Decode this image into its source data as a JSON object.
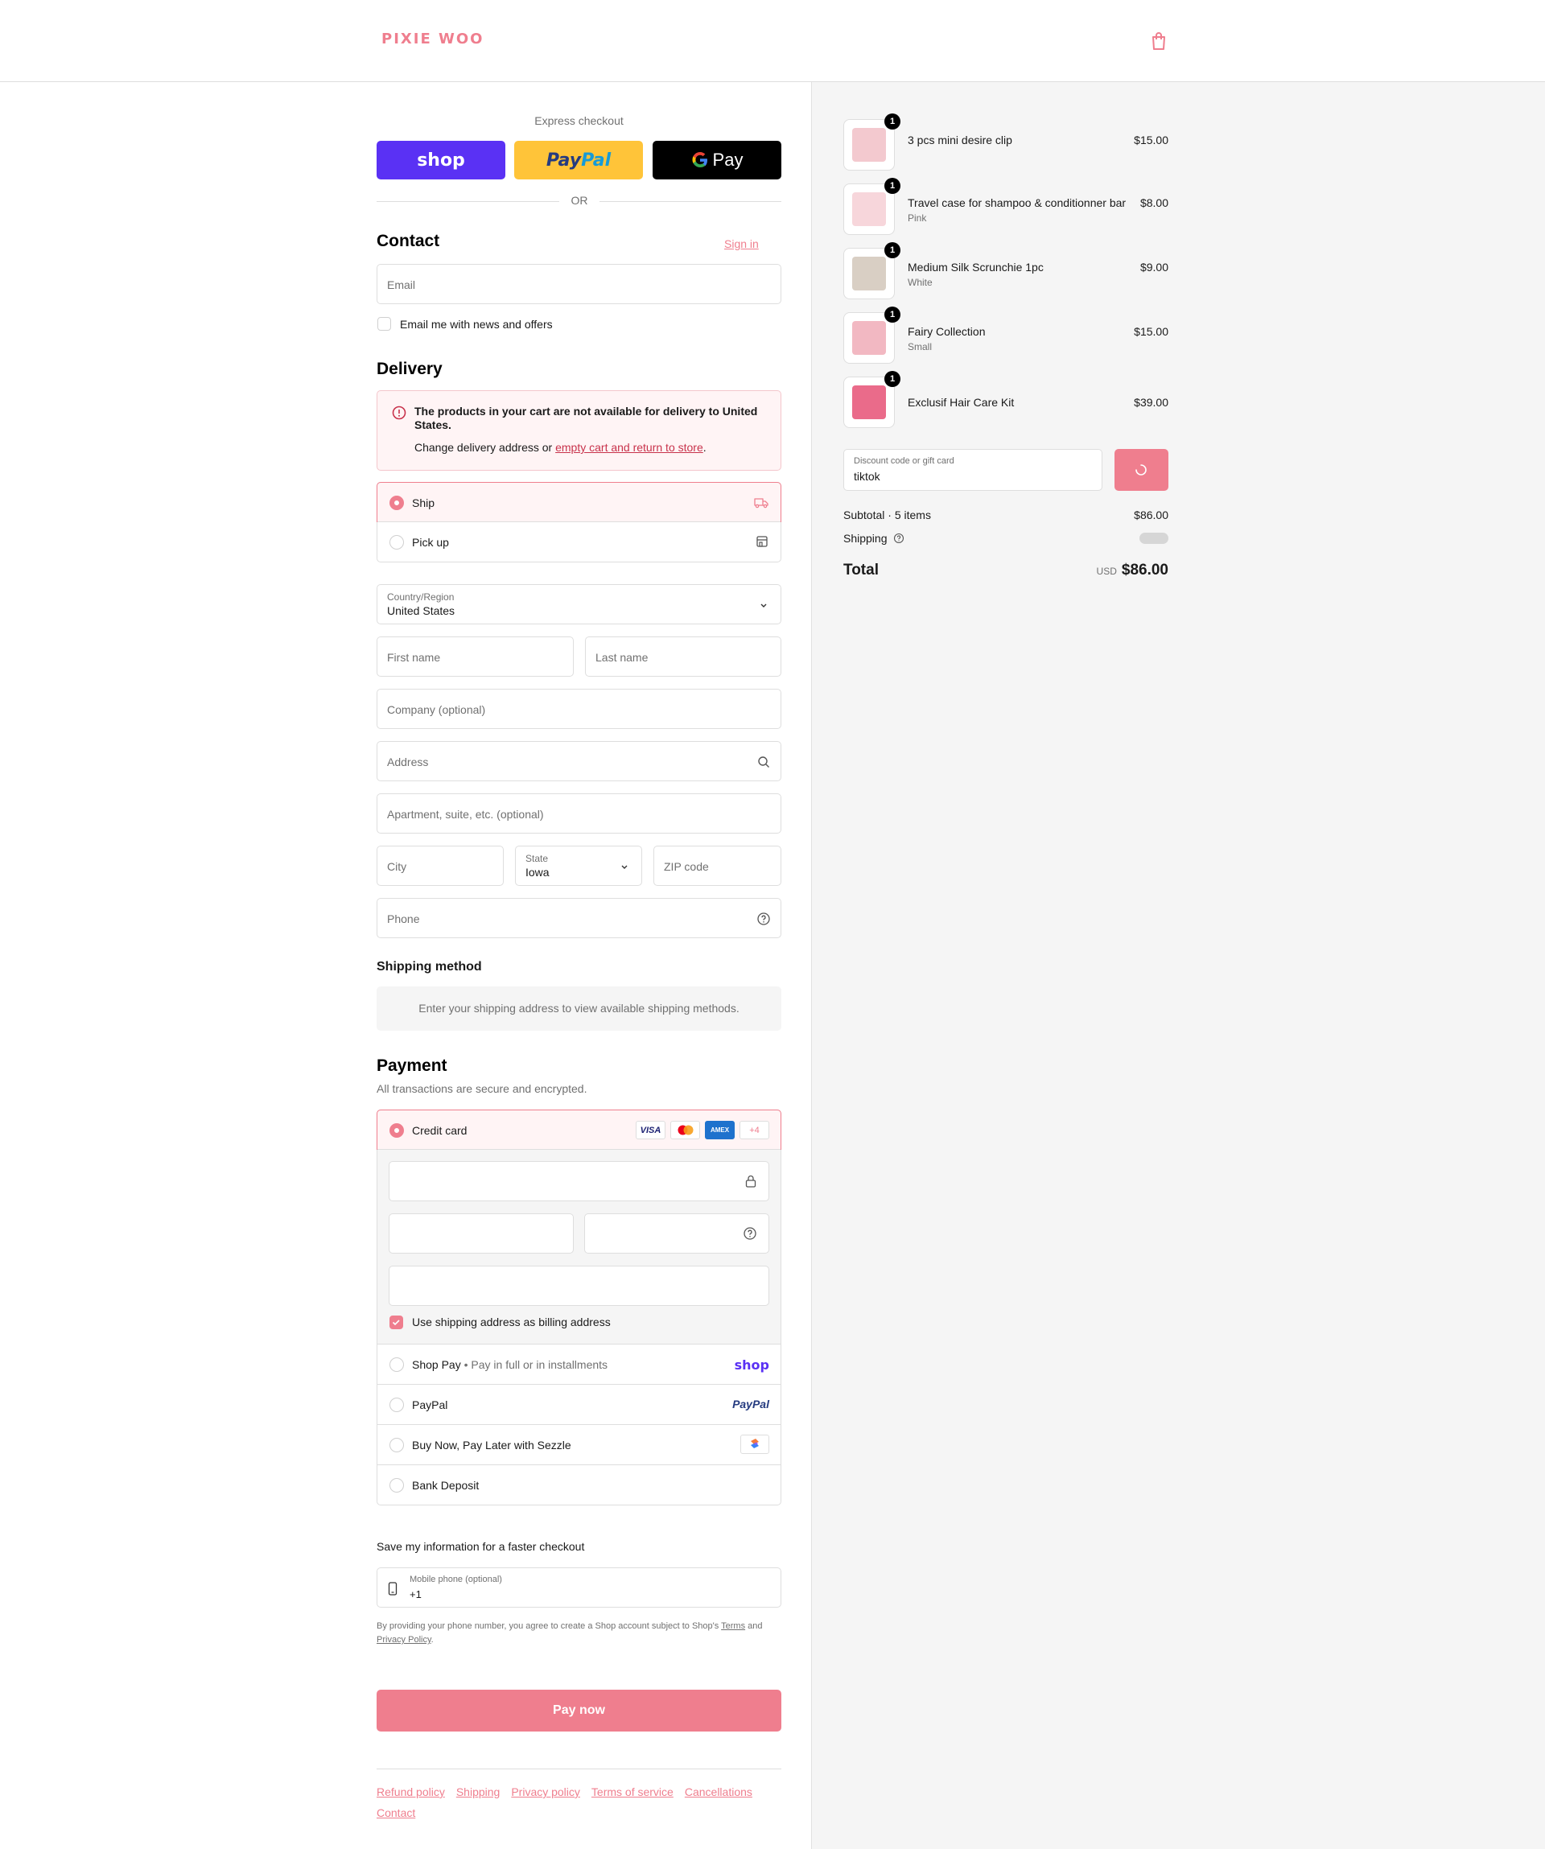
{
  "brand": {
    "logo": "PIXIE WOO",
    "accent": "#ef7e8e"
  },
  "express": {
    "title": "Express checkout",
    "shop_label": "shop",
    "paypal_label_1": "Pay",
    "paypal_label_2": "Pal",
    "gpay_label": "Pay",
    "or": "OR"
  },
  "contact": {
    "title": "Contact",
    "sign_in": "Sign in",
    "email_placeholder": "Email",
    "news_label": "Email me with news and offers"
  },
  "delivery": {
    "title": "Delivery",
    "alert_title": "The products in your cart are not available for delivery to United States.",
    "alert_text_1": "Change delivery address or ",
    "alert_link": "empty cart and return to store",
    "alert_text_2": ".",
    "options": [
      {
        "label": "Ship",
        "selected": true,
        "icon": "truck-icon"
      },
      {
        "label": "Pick up",
        "selected": false,
        "icon": "store-icon"
      }
    ],
    "country_label": "Country/Region",
    "country_value": "United States",
    "first_name": "First name",
    "last_name": "Last name",
    "company": "Company (optional)",
    "address": "Address",
    "apartment": "Apartment, suite, etc. (optional)",
    "city": "City",
    "state_label": "State",
    "state_value": "Iowa",
    "zip": "ZIP code",
    "phone": "Phone"
  },
  "shipping_method": {
    "title": "Shipping method",
    "hint": "Enter your shipping address to view available shipping methods."
  },
  "payment": {
    "title": "Payment",
    "subtitle": "All transactions are secure and encrypted.",
    "credit_card": "Credit card",
    "card_logos": [
      "VISA",
      "mastercard",
      "AMEX",
      "+4"
    ],
    "billing_same": "Use shipping address as billing address",
    "methods": [
      {
        "label": "Shop Pay",
        "sub": "Pay in full or in installments",
        "logo": "shop"
      },
      {
        "label": "PayPal",
        "sub": "",
        "logo": "PayPal"
      },
      {
        "label": "Buy Now, Pay Later with Sezzle",
        "sub": "",
        "logo": "sezzle-icon"
      },
      {
        "label": "Bank Deposit",
        "sub": "",
        "logo": ""
      }
    ]
  },
  "save_info": {
    "title": "Save my information for a faster checkout",
    "phone_label": "Mobile phone (optional)",
    "phone_value": "+1",
    "legal_1": "By providing your phone number, you agree to create a Shop account subject to Shop's ",
    "terms": "Terms",
    "legal_2": " and ",
    "privacy": "Privacy Policy",
    "legal_3": "."
  },
  "pay_now": "Pay now",
  "footer": {
    "links": [
      "Refund policy",
      "Shipping",
      "Privacy policy",
      "Terms of service",
      "Cancellations",
      "Contact"
    ]
  },
  "cart": {
    "items": [
      {
        "name": "3 pcs mini desire clip",
        "variant": "",
        "price": "$15.00",
        "qty": "1",
        "color": "#f3c9cf"
      },
      {
        "name": "Travel case for shampoo & conditionner bar",
        "variant": "Pink",
        "price": "$8.00",
        "qty": "1",
        "color": "#f7d6db"
      },
      {
        "name": "Medium Silk Scrunchie 1pc",
        "variant": "White",
        "price": "$9.00",
        "qty": "1",
        "color": "#d9cfc4"
      },
      {
        "name": "Fairy Collection",
        "variant": "Small",
        "price": "$15.00",
        "qty": "1",
        "color": "#f2b8c2"
      },
      {
        "name": "Exclusif Hair Care Kit",
        "variant": "",
        "price": "$39.00",
        "qty": "1",
        "color": "#ea6b8a"
      }
    ],
    "discount_label": "Discount code or gift card",
    "discount_value": "tiktok",
    "subtotal_label": "Subtotal · 5 items",
    "subtotal_value": "$86.00",
    "shipping_label": "Shipping",
    "total_label": "Total",
    "currency": "USD",
    "total_value": "$86.00"
  }
}
